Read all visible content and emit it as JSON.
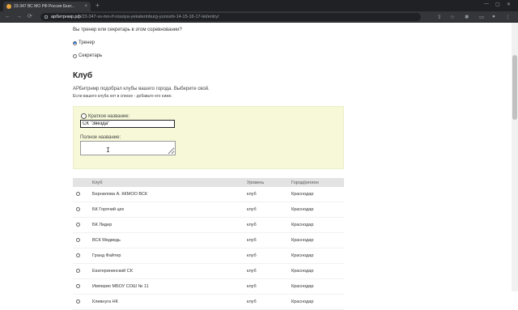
{
  "browser": {
    "tab_title": "23-347 ВС МО РФ Россия Екат...",
    "tab_close": "×",
    "new_tab": "+",
    "url_host": "арбитрнмр.рф",
    "url_path": "/23-347-vs-mo-rf-rossiya-yekaterinburg-yunoshi-14-15-16-17-let/entry/",
    "back": "←",
    "forward": "→",
    "reload": "⟳",
    "minimize": "—",
    "maximize": "▢",
    "close": "✕"
  },
  "role": {
    "question": "Вы тренер или секретарь в этом соревновании?",
    "options": [
      {
        "label": "Тренер",
        "checked": true
      },
      {
        "label": "Секретарь",
        "checked": false
      }
    ]
  },
  "club": {
    "title": "Клуб",
    "info1": "АРБитрнмр подобрал клубы вашего города. Выберите свой.",
    "info2": "Если вашего клуба нет в списке - добавьте его ниже.",
    "short_label": "Краткое название:",
    "short_value": "СК \"Звезда\"",
    "full_label": "Полное название:",
    "full_value": ""
  },
  "table": {
    "headers": {
      "club": "Клуб",
      "level": "Уровень",
      "city": "Город/регион"
    },
    "rows": [
      {
        "club": "Бернилова А. ККМОО ВСК",
        "level": "клуб",
        "city": "Краснодар"
      },
      {
        "club": "БК Горячий цех",
        "level": "клуб",
        "city": "Краснодар"
      },
      {
        "club": "БК Лидер",
        "level": "клуб",
        "city": "Краснодар"
      },
      {
        "club": "ВСК Медведь",
        "level": "клуб",
        "city": "Краснодар"
      },
      {
        "club": "Гранд Файтер",
        "level": "клуб",
        "city": "Краснодар"
      },
      {
        "club": "Екатерининский СК",
        "level": "клуб",
        "city": "Краснодар"
      },
      {
        "club": "Империо МБОУ СОШ № 11",
        "level": "клуб",
        "city": "Краснодар"
      },
      {
        "club": "Кливнуга НК",
        "level": "клуб",
        "city": "Краснодар"
      }
    ]
  }
}
